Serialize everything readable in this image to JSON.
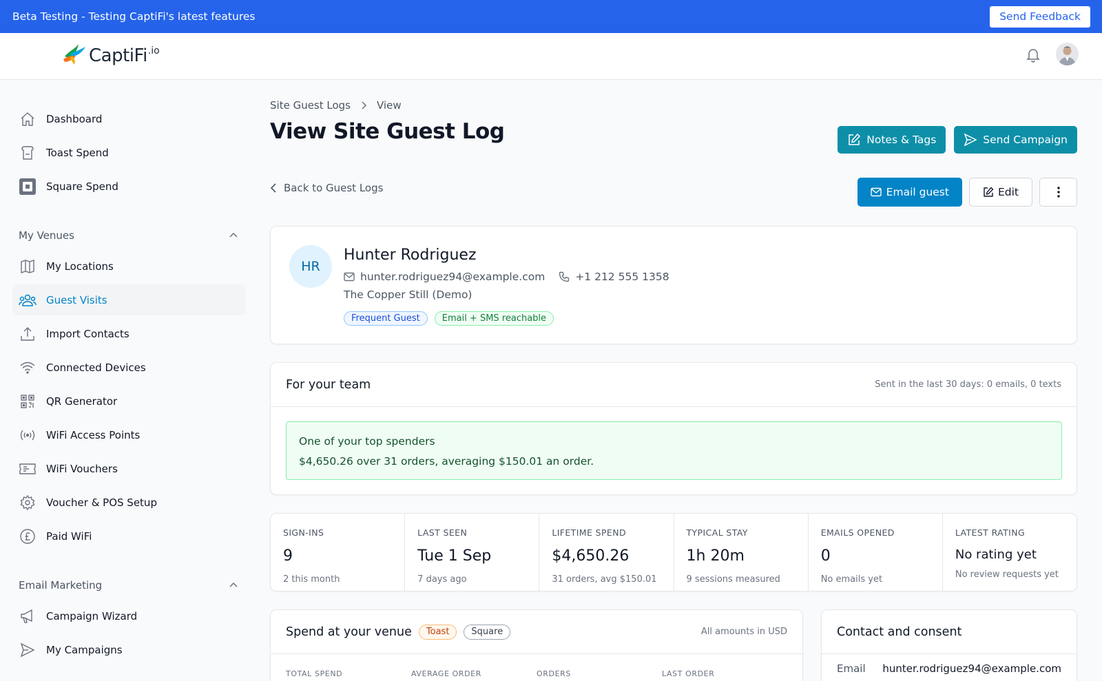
{
  "banner": {
    "text": "Beta Testing - Testing CaptiFi's latest features",
    "feedback_label": "Send Feedback"
  },
  "brand": {
    "name": "CaptiFi",
    "suffix": ".io"
  },
  "sidebar": {
    "top_items": [
      {
        "label": "Dashboard",
        "icon": "home-icon"
      },
      {
        "label": "Toast Spend",
        "icon": "toast-icon"
      },
      {
        "label": "Square Spend",
        "icon": "square-icon"
      }
    ],
    "venues_section": "My Venues",
    "venues_items": [
      {
        "label": "My Locations",
        "icon": "map-icon"
      },
      {
        "label": "Guest Visits",
        "icon": "users-icon",
        "active": true
      },
      {
        "label": "Import Contacts",
        "icon": "upload-icon"
      },
      {
        "label": "Connected Devices",
        "icon": "wifi-icon"
      },
      {
        "label": "QR Generator",
        "icon": "qr-icon"
      },
      {
        "label": "WiFi Access Points",
        "icon": "broadcast-icon"
      },
      {
        "label": "WiFi Vouchers",
        "icon": "ticket-icon"
      },
      {
        "label": "Voucher & POS Setup",
        "icon": "gear-icon"
      },
      {
        "label": "Paid WiFi",
        "icon": "pound-icon"
      }
    ],
    "email_section": "Email Marketing",
    "email_items": [
      {
        "label": "Campaign Wizard",
        "icon": "megaphone-icon"
      },
      {
        "label": "My Campaigns",
        "icon": "send-icon"
      }
    ]
  },
  "breadcrumb": {
    "parent": "Site Guest Logs",
    "current": "View"
  },
  "page": {
    "title": "View Site Guest Log"
  },
  "header_actions": {
    "notes_tags": "Notes & Tags",
    "send_campaign": "Send Campaign"
  },
  "actions": {
    "back": "Back to Guest Logs",
    "email_guest": "Email guest",
    "edit": "Edit"
  },
  "guest": {
    "initials": "HR",
    "name": "Hunter Rodriguez",
    "email": "hunter.rodriguez94@example.com",
    "phone": "+1 212 555 1358",
    "venue": "The Copper Still (Demo)",
    "tags": [
      "Frequent Guest",
      "Email + SMS reachable"
    ]
  },
  "team": {
    "title": "For your team",
    "sent_summary": "Sent in the last 30 days: 0 emails, 0 texts",
    "highlight_title": "One of your top spenders",
    "highlight_text": "$4,650.26 over 31 orders, averaging $150.01 an order."
  },
  "stats": [
    {
      "label": "SIGN-INS",
      "value": "9",
      "sub": "2 this month"
    },
    {
      "label": "LAST SEEN",
      "value": "Tue 1 Sep",
      "sub": "7 days ago"
    },
    {
      "label": "LIFETIME SPEND",
      "value": "$4,650.26",
      "sub": "31 orders, avg $150.01"
    },
    {
      "label": "TYPICAL STAY",
      "value": "1h 20m",
      "sub": "9 sessions measured"
    },
    {
      "label": "EMAILS OPENED",
      "value": "0",
      "sub": "No emails yet"
    },
    {
      "label": "LATEST RATING",
      "value": "No rating yet",
      "sub": "No review requests yet"
    }
  ],
  "spend": {
    "title": "Spend at your venue",
    "badges": [
      "Toast",
      "Square"
    ],
    "currency_note": "All amounts in USD",
    "columns": [
      "TOTAL SPEND",
      "AVERAGE ORDER",
      "ORDERS",
      "LAST ORDER"
    ]
  },
  "contact": {
    "title": "Contact and consent",
    "email_label": "Email",
    "email_value": "hunter.rodriguez94@example.com"
  }
}
